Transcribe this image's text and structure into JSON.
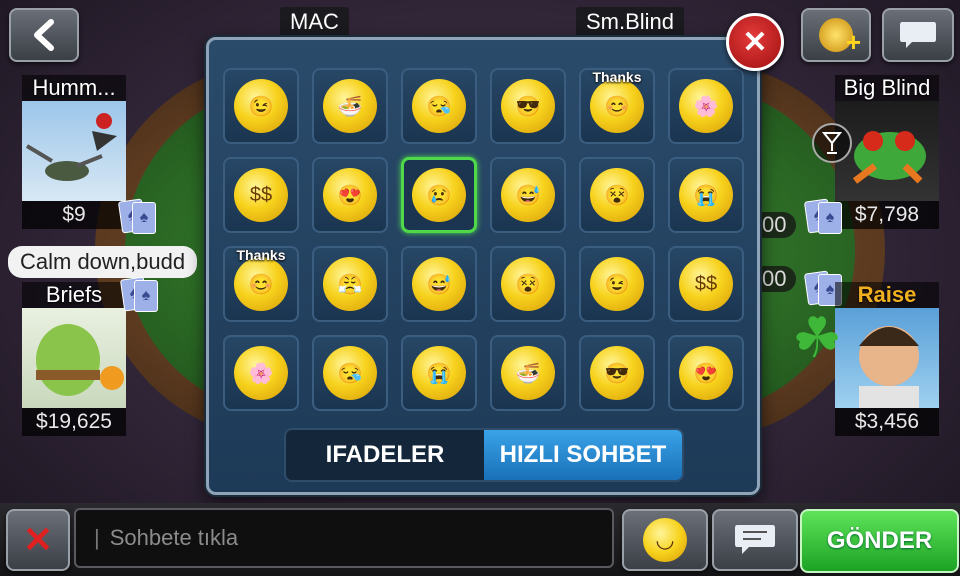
{
  "table": {
    "dealer_label": "MAC",
    "small_blind_label": "Sm.Blind",
    "pot_right_top": "00",
    "pot_right_bottom": "00"
  },
  "players": [
    {
      "name": "Humm...",
      "chips": "$9"
    },
    {
      "name": "Briefs",
      "chips": "$19,625",
      "chat_bubble": "Calm down,budd"
    },
    {
      "name": "Big Blind",
      "chips": "$7,798"
    },
    {
      "name": "Raise",
      "chips": "$3,456"
    }
  ],
  "emoji_panel": {
    "emojis": [
      {
        "name": "wink-thumbs-up",
        "glyph": "😉"
      },
      {
        "name": "eating-ramen",
        "glyph": "🍜"
      },
      {
        "name": "sleepy-sweat",
        "glyph": "😪"
      },
      {
        "name": "cool-sunglasses",
        "glyph": "😎"
      },
      {
        "name": "thanks-smile",
        "glyph": "😊",
        "tag": "Thanks"
      },
      {
        "name": "flower-smile",
        "glyph": "🌸"
      },
      {
        "name": "money-eyes",
        "glyph": "$$"
      },
      {
        "name": "heart-eyes",
        "glyph": "😍"
      },
      {
        "name": "sad-crying",
        "glyph": "😢",
        "selected": true
      },
      {
        "name": "laughing-sweat",
        "glyph": "😅"
      },
      {
        "name": "dizzy",
        "glyph": "😵"
      },
      {
        "name": "crying-hard",
        "glyph": "😭"
      },
      {
        "name": "thanks-smile-2",
        "glyph": "😊",
        "tag": "Thanks"
      },
      {
        "name": "angry-puff",
        "glyph": "😤"
      },
      {
        "name": "laughing-sweat-2",
        "glyph": "😅"
      },
      {
        "name": "dizzy-2",
        "glyph": "😵"
      },
      {
        "name": "wink-thumbs-up-2",
        "glyph": "😉"
      },
      {
        "name": "money-eyes-2",
        "glyph": "$$"
      },
      {
        "name": "flower-smile-2",
        "glyph": "🌸"
      },
      {
        "name": "sleepy-sweat-2",
        "glyph": "😪"
      },
      {
        "name": "crying-hard-2",
        "glyph": "😭"
      },
      {
        "name": "eating-ramen-2",
        "glyph": "🍜"
      },
      {
        "name": "cool-sunglasses-2",
        "glyph": "😎"
      },
      {
        "name": "heart-eyes-2",
        "glyph": "😍"
      }
    ],
    "tabs": [
      "IFADELER",
      "HIZLI SOHBET"
    ],
    "active_tab": 1
  },
  "bottom_bar": {
    "chat_placeholder": "Sohbete tıkla",
    "send_label": "GÖNDER"
  },
  "colors": {
    "active_tab": "#1971b8",
    "send_button": "#1da324",
    "close_button": "#c41a1a",
    "selected_cell": "#4ed84a"
  }
}
